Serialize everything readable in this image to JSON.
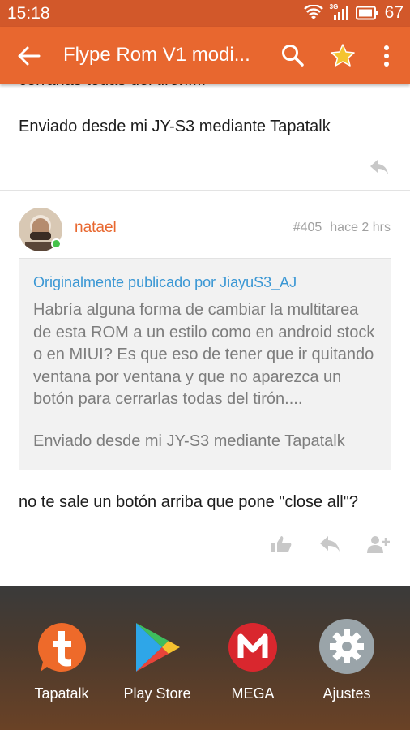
{
  "status_bar": {
    "time": "15:18",
    "network": "3G",
    "battery": "67"
  },
  "app_bar": {
    "title": "Flype Rom V1 modi..."
  },
  "previous_post": {
    "cut_line": "cerrarlas todas del tirón....",
    "signature": "Enviado desde mi JY-S3 mediante Tapatalk"
  },
  "post": {
    "username": "natael",
    "number": "#405",
    "time": "hace 2 hrs",
    "quote": {
      "author_line": "Originalmente publicado por JiayuS3_AJ",
      "lines": [
        "Habría alguna forma de cambiar la multitarea",
        "de esta ROM a un estilo como en android stock",
        "o en MIUI? Es que eso de tener que ir quitando",
        "ventana por ventana y que no aparezca un",
        "botón para cerrarlas todas del tirón...."
      ],
      "signature": "Enviado desde mi JY-S3 mediante Tapatalk"
    },
    "reply": "no te sale un botón arriba que pone \"close all\"?"
  },
  "dock": {
    "apps": [
      {
        "label": "Tapatalk",
        "icon": "tapatalk-icon",
        "color": "#ee6a2a"
      },
      {
        "label": "Play Store",
        "icon": "play-store-icon",
        "color": "#34a853"
      },
      {
        "label": "MEGA",
        "icon": "mega-icon",
        "color": "#d9272e"
      },
      {
        "label": "Ajustes",
        "icon": "settings-gear-icon",
        "color": "#8f9a9f"
      }
    ]
  },
  "colors": {
    "status_bar": "#d2582a",
    "app_bar": "#e8672f",
    "accent": "#e8672f",
    "link": "#3a97d4"
  }
}
